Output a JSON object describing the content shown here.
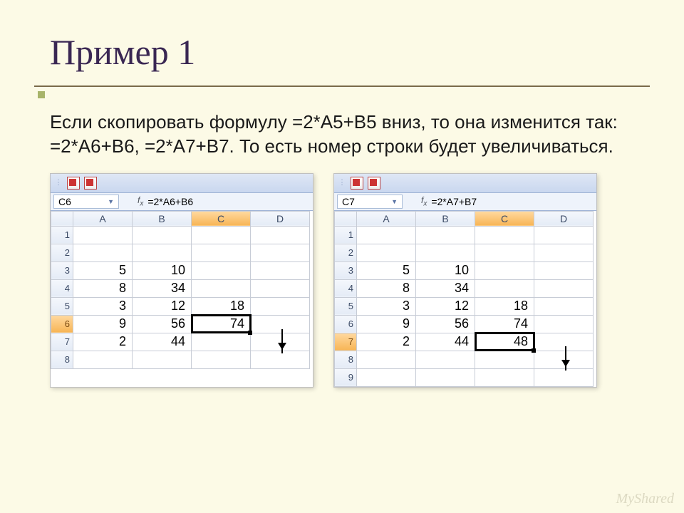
{
  "title": "Пример 1",
  "body": "Если скопировать формулу =2*A5+B5 вниз, то она изменится так: =2*A6+B6, =2*A7+B7. То есть номер строки будет увеличиваться.",
  "watermark": "MyShared",
  "columns": [
    "A",
    "B",
    "C",
    "D"
  ],
  "left": {
    "cellref": "C6",
    "formula": "=2*A6+B6",
    "selectedCol": "C",
    "selectedRow": 6,
    "rows": [
      {
        "n": 1
      },
      {
        "n": 2
      },
      {
        "n": 3,
        "A": "5",
        "B": "10"
      },
      {
        "n": 4,
        "A": "8",
        "B": "34"
      },
      {
        "n": 5,
        "A": "3",
        "B": "12",
        "C": "18"
      },
      {
        "n": 6,
        "A": "9",
        "B": "56",
        "C": "74",
        "cursor": true
      },
      {
        "n": 7,
        "A": "2",
        "B": "44"
      },
      {
        "n": 8
      }
    ]
  },
  "right": {
    "cellref": "C7",
    "formula": "=2*A7+B7",
    "selectedCol": "C",
    "selectedRow": 7,
    "rows": [
      {
        "n": 1
      },
      {
        "n": 2
      },
      {
        "n": 3,
        "A": "5",
        "B": "10"
      },
      {
        "n": 4,
        "A": "8",
        "B": "34"
      },
      {
        "n": 5,
        "A": "3",
        "B": "12",
        "C": "18"
      },
      {
        "n": 6,
        "A": "9",
        "B": "56",
        "C": "74"
      },
      {
        "n": 7,
        "A": "2",
        "B": "44",
        "C": "48",
        "cursor": true
      },
      {
        "n": 8
      },
      {
        "n": 9
      }
    ]
  }
}
